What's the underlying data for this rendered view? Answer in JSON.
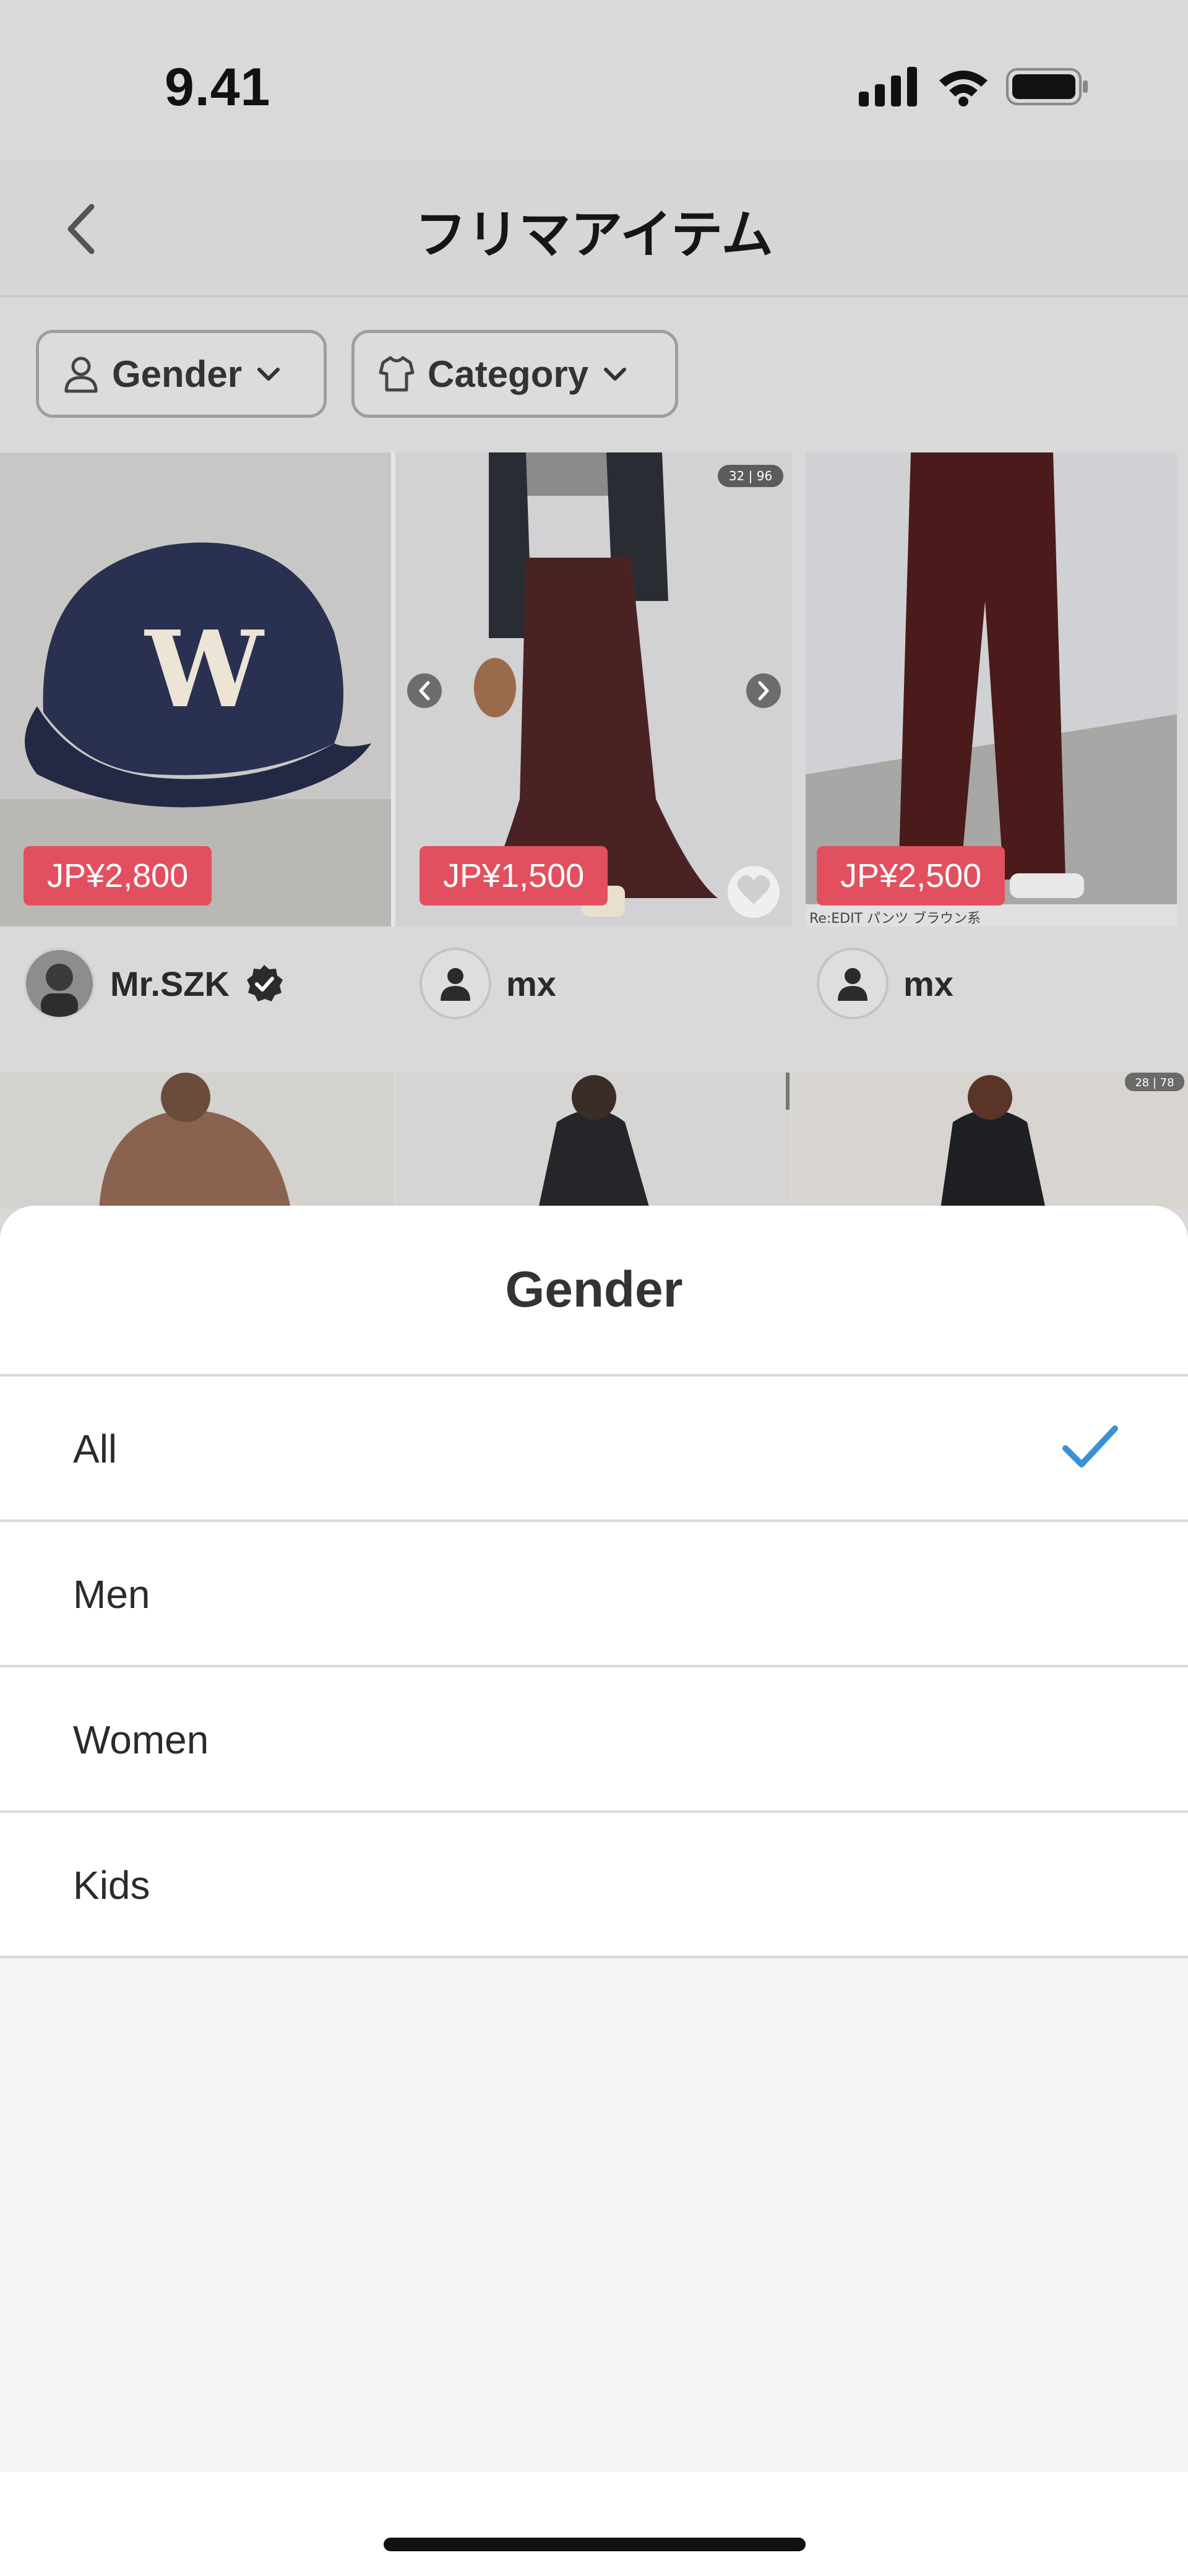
{
  "status_bar": {
    "time": "9.41",
    "icons": [
      "signal-icon",
      "wifi-icon",
      "battery-icon"
    ]
  },
  "header": {
    "title": "フリマアイテム",
    "back_icon": "chevron-left-icon"
  },
  "filters": {
    "gender_label": "Gender",
    "category_label": "Category"
  },
  "products": [
    {
      "price": "JP¥2,800",
      "seller": "Mr.SZK",
      "verified": true
    },
    {
      "price": "JP¥1,500",
      "seller": "mx",
      "verified": false,
      "counter": "32 | 96"
    },
    {
      "price": "JP¥2,500",
      "seller": "mx",
      "verified": false,
      "caption": "Re:EDIT パンツ ブラウン系"
    }
  ],
  "row2": {
    "counter": "28 | 78"
  },
  "sheet": {
    "title": "Gender",
    "options": [
      {
        "label": "All",
        "selected": true
      },
      {
        "label": "Men",
        "selected": false
      },
      {
        "label": "Women",
        "selected": false
      },
      {
        "label": "Kids",
        "selected": false
      }
    ]
  },
  "colors": {
    "price_badge": "#e2505f",
    "check": "#3a92d6"
  }
}
